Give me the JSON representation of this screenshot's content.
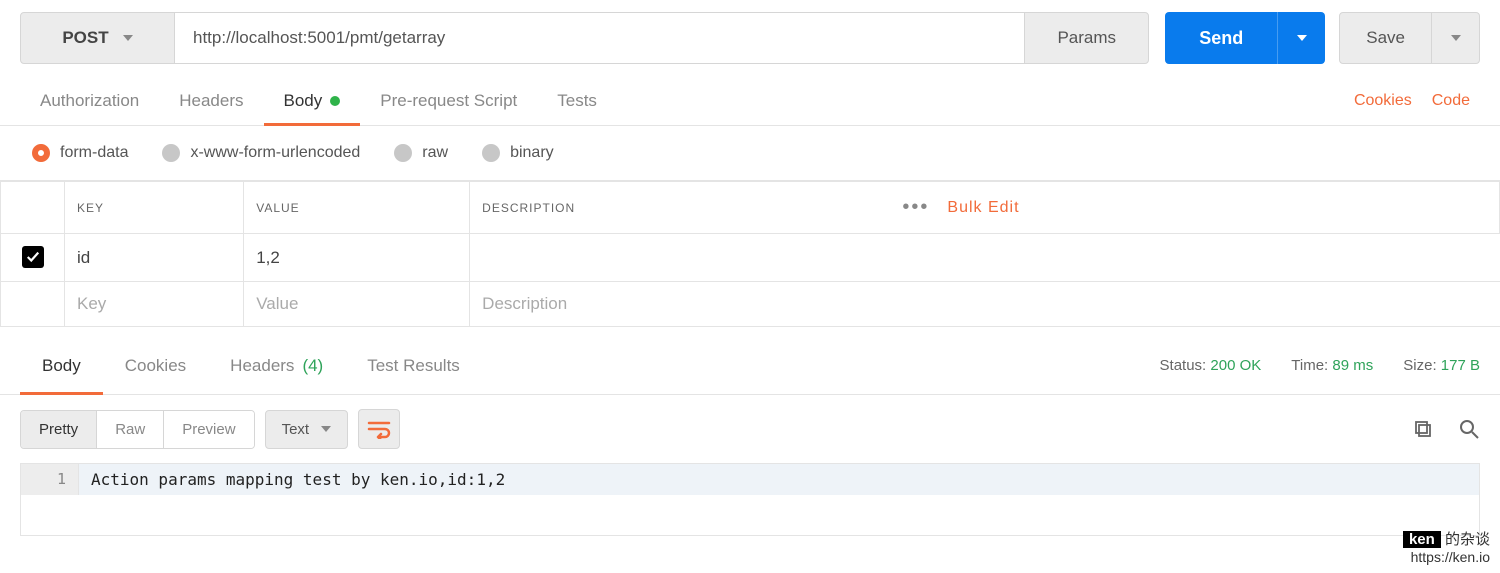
{
  "request": {
    "method": "POST",
    "url": "http://localhost:5001/pmt/getarray",
    "params_label": "Params",
    "send_label": "Send",
    "save_label": "Save"
  },
  "req_tabs": {
    "authorization": "Authorization",
    "headers": "Headers",
    "body": "Body",
    "prerequest": "Pre-request Script",
    "tests": "Tests",
    "cookies_link": "Cookies",
    "code_link": "Code"
  },
  "body_types": {
    "form_data": "form-data",
    "urlencoded": "x-www-form-urlencoded",
    "raw": "raw",
    "binary": "binary"
  },
  "params_table": {
    "headers": {
      "key": "KEY",
      "value": "VALUE",
      "description": "DESCRIPTION"
    },
    "bulk_edit": "Bulk Edit",
    "rows": [
      {
        "checked": true,
        "key": "id",
        "value": "1,2",
        "description": ""
      }
    ],
    "placeholders": {
      "key": "Key",
      "value": "Value",
      "description": "Description"
    }
  },
  "resp_tabs": {
    "body": "Body",
    "cookies": "Cookies",
    "headers": "Headers",
    "headers_count": "(4)",
    "test_results": "Test Results"
  },
  "resp_meta": {
    "status_label": "Status:",
    "status_value": "200 OK",
    "time_label": "Time:",
    "time_value": "89 ms",
    "size_label": "Size:",
    "size_value": "177 B"
  },
  "resp_toolbar": {
    "pretty": "Pretty",
    "raw": "Raw",
    "preview": "Preview",
    "format": "Text"
  },
  "response_body": {
    "line_no": "1",
    "text": "Action params mapping test by ken.io,id:1,2"
  },
  "watermark": {
    "badge": "ken",
    "tag": " 的杂谈",
    "url": "https://ken.io"
  }
}
